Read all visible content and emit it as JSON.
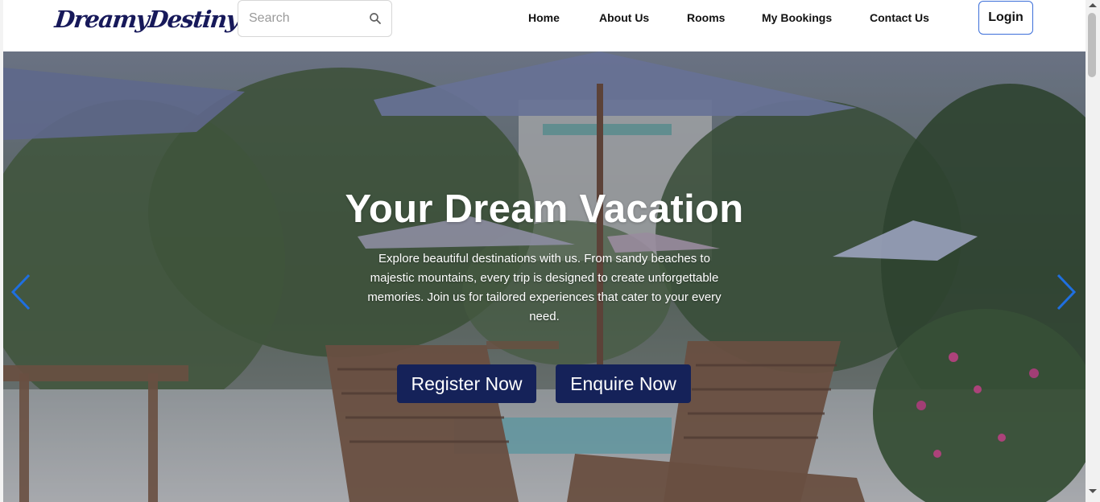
{
  "brand": {
    "logo_text": "DreamyDestiny",
    "primary_color": "#17195a",
    "button_color": "#152259",
    "login_border_color": "#3c6fd9",
    "arrow_color": "#1f6fe0"
  },
  "search": {
    "placeholder": "Search",
    "value": "",
    "icon": "search-icon"
  },
  "nav": {
    "items": [
      {
        "label": "Home"
      },
      {
        "label": "About Us"
      },
      {
        "label": "Rooms"
      },
      {
        "label": "My Bookings"
      },
      {
        "label": "Contact Us"
      }
    ],
    "login_label": "Login"
  },
  "hero": {
    "title": "Your Dream Vacation",
    "description": "Explore beautiful destinations with us. From sandy beaches to majestic mountains, every trip is designed to create unforgettable memories. Join us for tailored experiences that cater to your every need.",
    "register_label": "Register Now",
    "enquire_label": "Enquire Now",
    "prev_icon": "chevron-left-icon",
    "next_icon": "chevron-right-icon"
  }
}
